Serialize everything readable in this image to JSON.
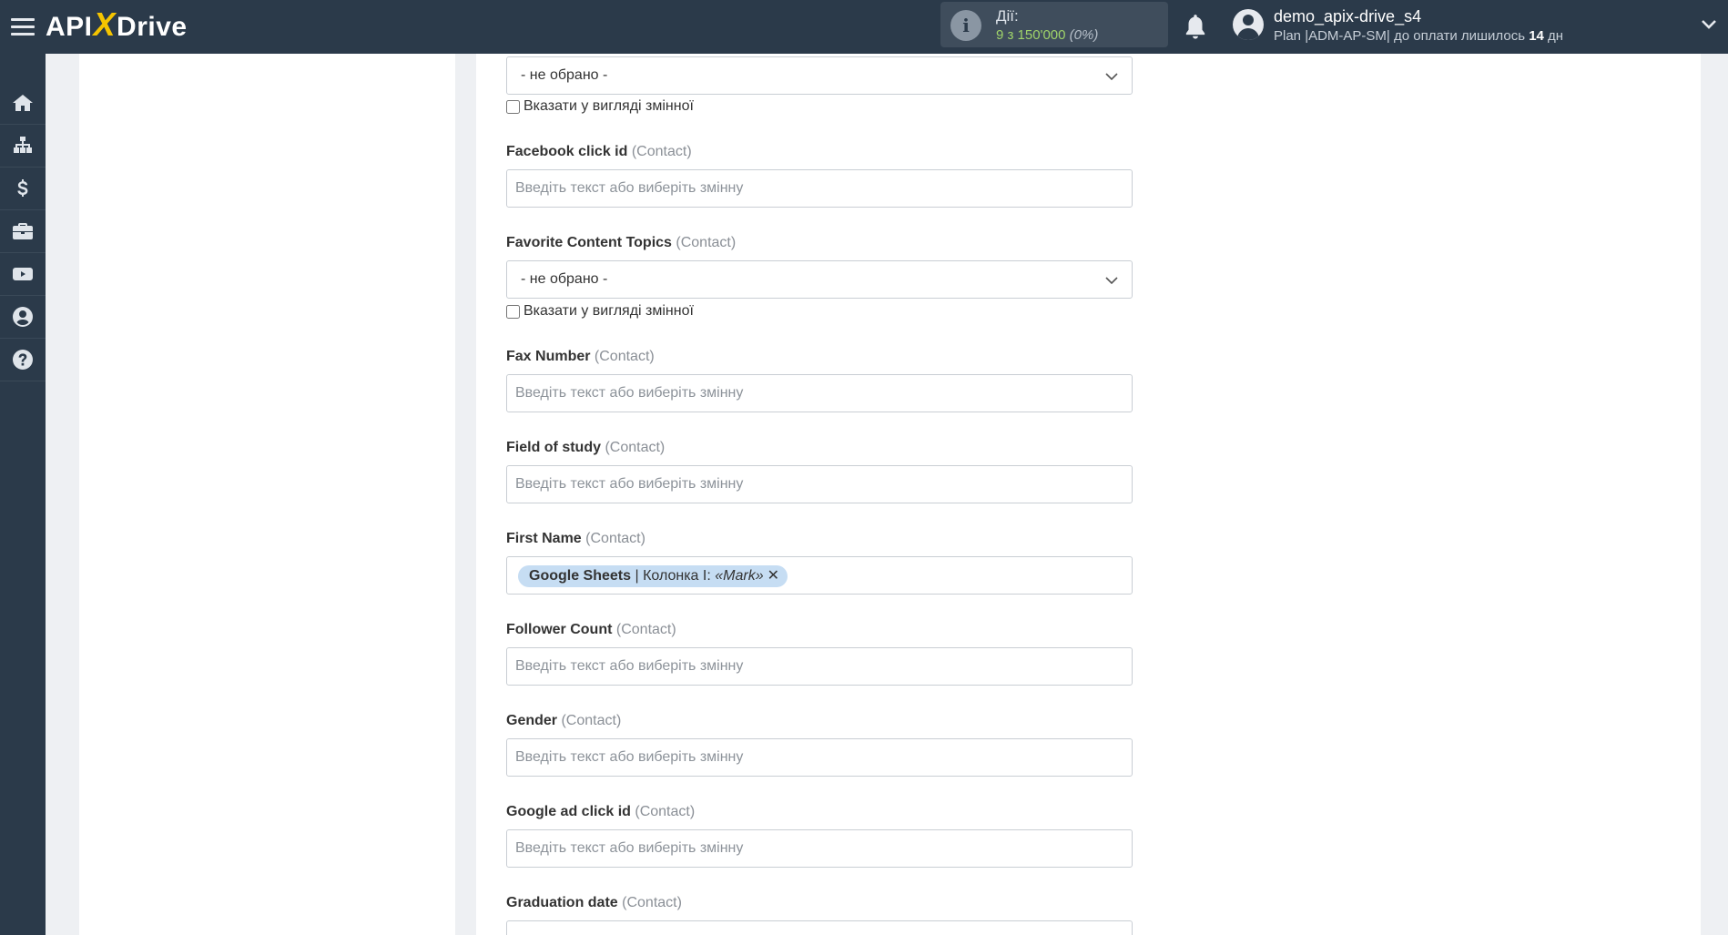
{
  "header": {
    "logo_api": "API",
    "logo_x": "X",
    "logo_drive": "Drive",
    "actions_label": "Дії:",
    "actions_used": "9 з 150'000",
    "actions_percent": "(0%)",
    "user_name": "demo_apix-drive_s4",
    "plan_text": "Plan |ADM-AP-SM| до оплати лишилось",
    "plan_days": "14",
    "plan_days_unit": "дн"
  },
  "sidebar": {
    "items": [
      {
        "icon": "home-icon"
      },
      {
        "icon": "sitemap-icon"
      },
      {
        "icon": "dollar-icon"
      },
      {
        "icon": "briefcase-icon"
      },
      {
        "icon": "youtube-icon"
      },
      {
        "icon": "user-circle-icon"
      },
      {
        "icon": "help-icon"
      }
    ]
  },
  "form": {
    "placeholder": "Введіть текст або виберіть змінну",
    "select_none": "- не обрано -",
    "var_checkbox": "Вказати у вигляді змінної",
    "context": "(Contact)",
    "fields": {
      "facebook_click_id": "Facebook click id",
      "favorite_content_topics": "Favorite Content Topics",
      "fax_number": "Fax Number",
      "field_of_study": "Field of study",
      "first_name": "First Name",
      "follower_count": "Follower Count",
      "gender": "Gender",
      "google_ad_click_id": "Google ad click id",
      "graduation_date": "Graduation date"
    },
    "first_name_tag": {
      "source": "Google Sheets",
      "column": "| Колонка I:",
      "value": "«Mark»",
      "remove": "✕"
    }
  },
  "colors": {
    "topbar": "#2b3a4a",
    "accent": "#f5c400",
    "tag_bg": "#c6ddf3",
    "actions_green": "#9fd36a"
  }
}
